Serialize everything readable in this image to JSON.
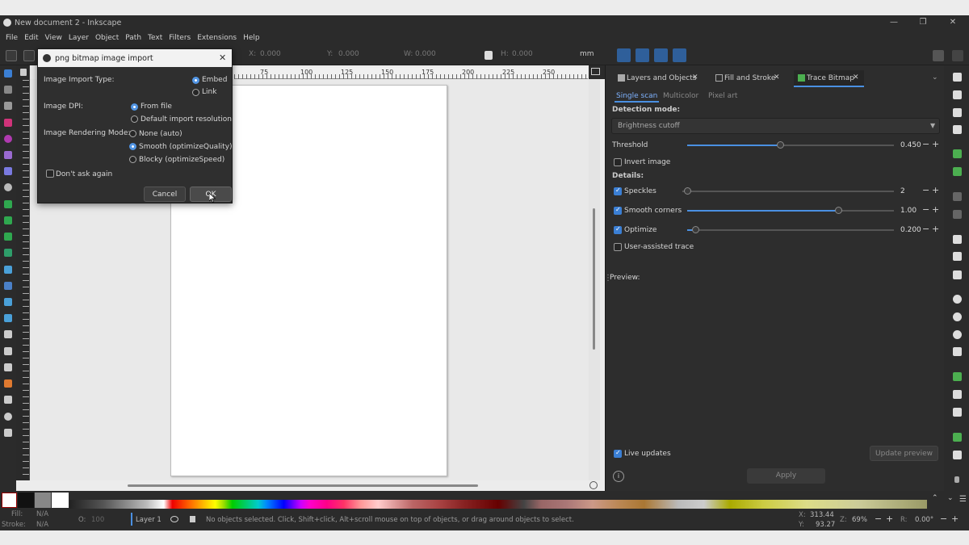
{
  "window": {
    "title": "New document 2 - Inkscape"
  },
  "menu": [
    "File",
    "Edit",
    "View",
    "Layer",
    "Object",
    "Path",
    "Text",
    "Filters",
    "Extensions",
    "Help"
  ],
  "toolbar": {
    "x_label": "X:",
    "x_value": "0.000",
    "y_label": "Y:",
    "y_value": "0.000",
    "w_label": "W:",
    "w_value": "0.000",
    "h_label": "H:",
    "h_value": "0.000",
    "unit": "mm"
  },
  "ruler": [
    "75",
    "100",
    "125",
    "150",
    "175",
    "200",
    "225",
    "250"
  ],
  "dialog": {
    "title": "png bitmap image import",
    "import_type_label": "Image Import Type:",
    "embed": "Embed",
    "link": "Link",
    "dpi_label": "Image DPI:",
    "from_file": "From file",
    "default_res": "Default import resolution",
    "rendering_label": "Image Rendering Mode:",
    "none_auto": "None (auto)",
    "smooth": "Smooth (optimizeQuality)",
    "blocky": "Blocky (optimizeSpeed)",
    "dont_ask": "Don't ask again",
    "cancel": "Cancel",
    "ok": "OK"
  },
  "dock": {
    "tabs": [
      "Layers and Objects",
      "Fill and Stroke",
      "Trace Bitmap"
    ],
    "subtabs": [
      "Single scan",
      "Multicolor",
      "Pixel art"
    ],
    "detection_label": "Detection mode:",
    "detection_value": "Brightness cutoff",
    "threshold_label": "Threshold",
    "threshold_value": "0.450",
    "threshold_fraction": 0.45,
    "invert_label": "Invert image",
    "details_label": "Details:",
    "speckles_label": "Speckles",
    "speckles_value": "2",
    "smooth_label": "Smooth corners",
    "smooth_value": "1.00",
    "optimize_label": "Optimize",
    "optimize_value": "0.200",
    "user_assisted": "User-assisted trace",
    "preview_label": "Preview:",
    "live_updates": "Live updates",
    "update_preview": "Update preview",
    "apply": "Apply"
  },
  "status": {
    "fill_label": "Fill:",
    "fill_value": "N/A",
    "stroke_label": "Stroke:",
    "stroke_value": "N/A",
    "opacity_label": "O:",
    "opacity_value": "100",
    "layer": "Layer 1",
    "message": "No objects selected. Click, Shift+click, Alt+scroll mouse on top of objects, or drag around objects to select.",
    "x_label": "X:",
    "x_value": "313.44",
    "y_label": "Y:",
    "y_value": "93.27",
    "zoom_label": "Z:",
    "zoom_value": "69%",
    "rotation_label": "R:",
    "rotation_value": "0.00°"
  },
  "colors": {
    "accent": "#4a90e2",
    "dark_bg": "#2d2d2d"
  }
}
